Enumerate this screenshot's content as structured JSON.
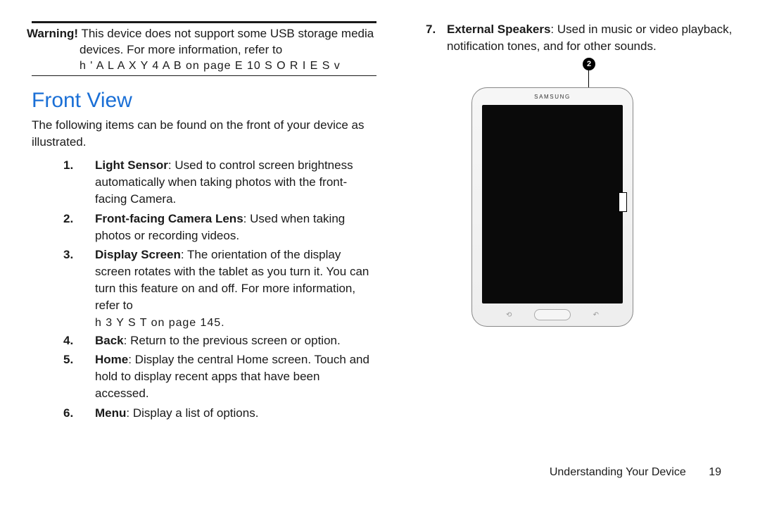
{
  "left": {
    "warning_label": "Warning!",
    "warning_text": "This device does not support some USB storage media devices. For more information, refer to",
    "warning_ref": "h ' A L A X Y   4 A B   on page   E 10  S O R I E S v",
    "section_title": "Front View",
    "intro": "The following items can be found on the front of your device as illustrated.",
    "items": [
      {
        "num": "1.",
        "term": "Light Sensor",
        "desc": ": Used to control screen brightness automatically when taking photos with the front-facing Camera."
      },
      {
        "num": "2.",
        "term": "Front-facing Camera Lens",
        "desc": ": Used when taking photos or recording videos."
      },
      {
        "num": "3.",
        "term": "Display Screen",
        "desc": ": The orientation of the display screen rotates with the tablet as you turn it. You can turn this feature on and off. For more information, refer to"
      },
      {
        "num": "4.",
        "term": "Back",
        "desc": ": Return to the previous screen or option."
      },
      {
        "num": "5.",
        "term": "Home",
        "desc": ": Display the central Home screen. Touch and hold to display recent apps that have been accessed."
      },
      {
        "num": "6.",
        "term": "Menu",
        "desc": ": Display a list of options."
      }
    ],
    "item3_ref": "h 3 Y S T on page 145."
  },
  "right": {
    "items": [
      {
        "num": "7.",
        "term": "External Speakers",
        "desc": ": Used in music or video playback, notification tones, and for other sounds."
      }
    ],
    "callout_label": "2",
    "device_brand": "SAMSUNG",
    "soft_left_icon": "⟲",
    "soft_right_icon": "↶"
  },
  "footer": {
    "section": "Understanding Your Device",
    "page": "19"
  }
}
